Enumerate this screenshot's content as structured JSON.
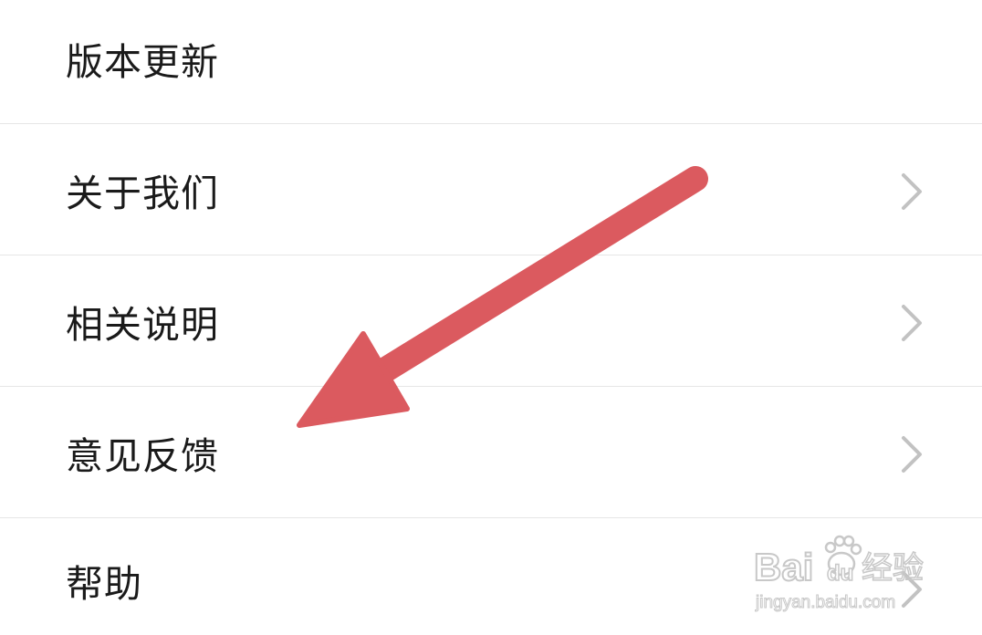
{
  "menu": {
    "items": [
      {
        "label": "版本更新",
        "has_chevron": false
      },
      {
        "label": "关于我们",
        "has_chevron": true
      },
      {
        "label": "相关说明",
        "has_chevron": true
      },
      {
        "label": "意见反馈",
        "has_chevron": true
      },
      {
        "label": "帮助",
        "has_chevron": true
      }
    ]
  },
  "annotation": {
    "arrow_color": "#db5a5f",
    "points_to": "意见反馈"
  },
  "watermark": {
    "brand": "Bai",
    "brand_suffix": "du",
    "service": "经验",
    "url": "jingyan.baidu.com"
  },
  "colors": {
    "background": "#ffffff",
    "text": "#1a1a1a",
    "divider": "#e6e6e6",
    "chevron": "#c2c2c2"
  }
}
